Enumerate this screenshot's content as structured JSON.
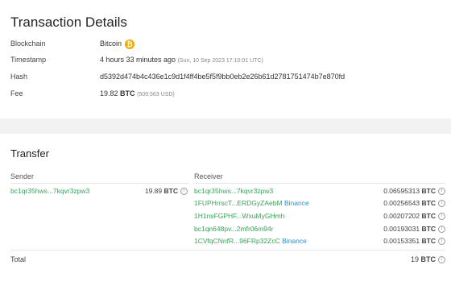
{
  "details": {
    "title": "Transaction Details",
    "blockchain": {
      "label": "Blockchain",
      "value": "Bitcoin",
      "icon": "bitcoin-icon",
      "icon_glyph": "₿",
      "icon_color": "#f2a900"
    },
    "timestamp": {
      "label": "Timestamp",
      "value": "4 hours 33 minutes ago",
      "sub": "(Sun, 10 Sep 2023 17:10:01 UTC)"
    },
    "hash": {
      "label": "Hash",
      "value": "d5392d474b4c436e1c9d1f4ff4be5f5f9bb0eb2e26b61d2781751474b7e870fd"
    },
    "fee": {
      "label": "Fee",
      "amount": "19.82",
      "unit": "BTC",
      "sub": "(509,563 USD)"
    }
  },
  "transfer": {
    "title": "Transfer",
    "sender_header": "Sender",
    "receiver_header": "Receiver",
    "senders": [
      {
        "address": "bc1qr35hws...7kqvr3zpw3",
        "amount": "19.89",
        "unit": "BTC"
      }
    ],
    "receivers": [
      {
        "address": "bc1qr35hws...7kqvr3zpw3",
        "tag": "",
        "amount": "0.06595313",
        "unit": "BTC"
      },
      {
        "address": "1FUPHrrscT...ERDGyZAebM",
        "tag": "Binance",
        "amount": "0.00256543",
        "unit": "BTC"
      },
      {
        "address": "1H1nsFGPHF...WxuMyGHmh",
        "tag": "",
        "amount": "0.00207202",
        "unit": "BTC"
      },
      {
        "address": "bc1qn648pv...2mfr06m94r",
        "tag": "",
        "amount": "0.00193031",
        "unit": "BTC"
      },
      {
        "address": "1CVfqCNnfR...96FRp32ZcC",
        "tag": "Binance",
        "amount": "0.00153351",
        "unit": "BTC"
      }
    ],
    "total_label": "Total",
    "total_amount": "19",
    "total_unit": "BTC",
    "info_glyph": "i"
  },
  "colors": {
    "address_green": "#3aa55a",
    "tag_blue": "#2b8fd6",
    "bitcoin_orange": "#f2a900"
  }
}
